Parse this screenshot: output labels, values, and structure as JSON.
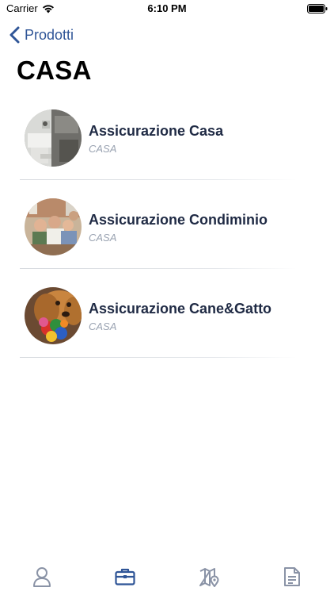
{
  "status_bar": {
    "carrier": "Carrier",
    "time": "6:10 PM"
  },
  "nav": {
    "back_label": "Prodotti",
    "back_icon": "chevron-left-icon"
  },
  "page": {
    "title": "CASA"
  },
  "products": [
    {
      "name": "Assicurazione Casa",
      "category": "CASA",
      "thumbnail": "kitchen-photo"
    },
    {
      "name": "Assicurazione Condiminio",
      "category": "CASA",
      "thumbnail": "family-photo"
    },
    {
      "name": "Assicurazione Cane&Gatto",
      "category": "CASA",
      "thumbnail": "dog-photo"
    }
  ],
  "tab_bar": {
    "items": [
      {
        "icon": "user-icon",
        "active": false
      },
      {
        "icon": "briefcase-icon",
        "active": true
      },
      {
        "icon": "map-pin-icon",
        "active": false
      },
      {
        "icon": "document-icon",
        "active": false
      }
    ]
  },
  "colors": {
    "accent": "#2f5597",
    "inactive_icon": "#8a93a6",
    "title_text": "#1f2a44",
    "subtitle_text": "#9aa3b2"
  }
}
